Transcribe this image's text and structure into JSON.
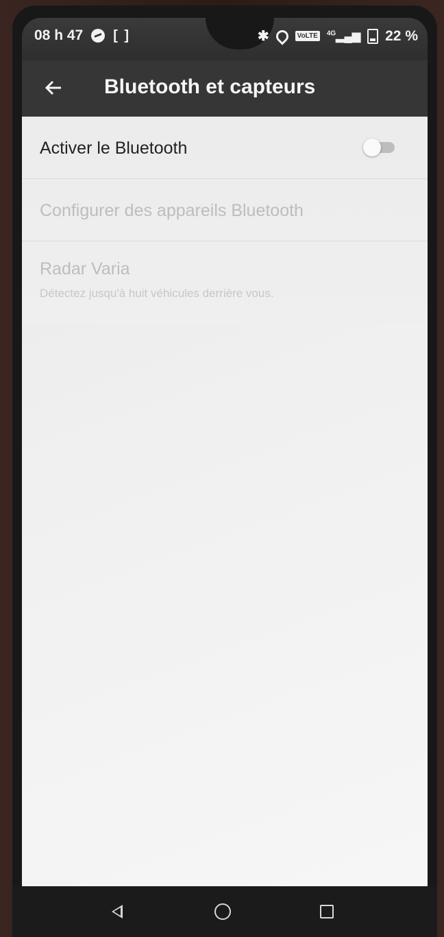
{
  "status_bar": {
    "time": "08 h 47",
    "volte_label": "VoLTE",
    "network": "4G",
    "battery": "22 %",
    "icons": [
      "messenger-icon",
      "screen-capture-icon",
      "bluetooth-icon",
      "location-icon",
      "volte-icon",
      "signal-icon",
      "battery-icon"
    ]
  },
  "app_bar": {
    "title": "Bluetooth et capteurs",
    "back_icon": "arrow-left-icon"
  },
  "settings": {
    "enable_bluetooth": {
      "label": "Activer le Bluetooth",
      "toggle_on": false
    },
    "configure_devices": {
      "label": "Configurer des appareils Bluetooth",
      "enabled": false
    },
    "radar_varia": {
      "label": "Radar Varia",
      "description": "Détectez jusqu'à huit véhicules derrière vous.",
      "enabled": false
    }
  },
  "nav_bar": {
    "icons": [
      "back-triangle-icon",
      "home-circle-icon",
      "recents-square-icon"
    ]
  },
  "colors": {
    "app_bar": "#363636",
    "content_bg": "#efefef",
    "disabled_text": "#bdbdbd"
  }
}
